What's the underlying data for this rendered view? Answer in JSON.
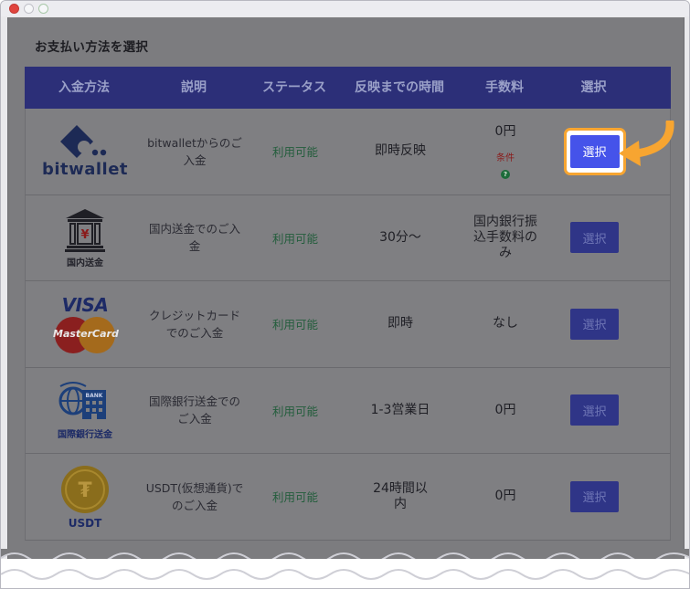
{
  "page": {
    "title": "お支払い方法を選択"
  },
  "table": {
    "headers": [
      "入金方法",
      "説明",
      "ステータス",
      "反映までの時間",
      "手数料",
      "選択"
    ],
    "rows": [
      {
        "logo": "bitwallet",
        "logo_caption": "bitwallet",
        "description": "bitwalletからのご入金",
        "status": "利用可能",
        "time": "即時反映",
        "fee": "0円",
        "fee_note": "条件",
        "fee_help": "?",
        "select": "選択"
      },
      {
        "logo": "bank-building-yen-icon",
        "logo_caption": "国内送金",
        "description": "国内送金でのご入金",
        "status": "利用可能",
        "time": "30分〜",
        "fee": "国内銀行振込手数料のみ",
        "select": "選択"
      },
      {
        "logo": "visa-mastercard",
        "logo_caption": "VISA",
        "logo_caption2": "MasterCard",
        "description": "クレジットカードでのご入金",
        "status": "利用可能",
        "time": "即時",
        "fee": "なし",
        "select": "選択"
      },
      {
        "logo": "international-bank-icon",
        "logo_caption": "国際銀行送金",
        "logo_badge": "BANK",
        "description": "国際銀行送金でのご入金",
        "status": "利用可能",
        "time": "1-3営業日",
        "fee": "0円",
        "select": "選択"
      },
      {
        "logo": "usdt-coin-icon",
        "logo_caption": "USDT",
        "description": "USDT(仮想通貨)でのご入金",
        "status": "利用可能",
        "time": "24時間以内",
        "fee": "0円",
        "select": "選択"
      }
    ]
  },
  "colors": {
    "header_bg": "#2c2f78",
    "highlight": "#f7a531",
    "primary_button": "#4553ea"
  }
}
